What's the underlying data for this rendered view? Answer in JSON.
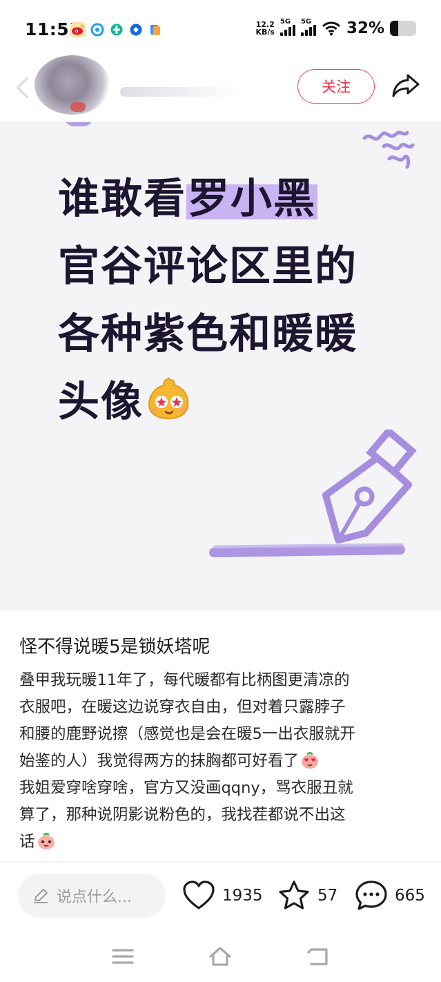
{
  "status_bar": {
    "time": "11:55",
    "net_speed_value": "12.2",
    "net_speed_unit": "KB/s",
    "signal1_label": "5G",
    "signal2_label": "5G",
    "battery_percent": "32%",
    "battery_level": 0.32,
    "app_icons": [
      "weibo-icon",
      "browser-icon",
      "ticket-app-icon",
      "blue-app-icon",
      "files-icon"
    ]
  },
  "header": {
    "follow_label": "关注"
  },
  "hero": {
    "line1_plain": "谁敢看",
    "line1_highlight": "罗小黑",
    "line2": "官谷评论区里的",
    "line3": "各种紫色和暖暖",
    "line4": "头像"
  },
  "post": {
    "title": "怪不得说暖5是锁妖塔呢",
    "lines": [
      "叠甲我玩暖11年了，每代暖都有比柄图更清凉的",
      "衣服吧，在暖这边说穿衣自由，但对着只露脖子",
      "和腰的鹿野说擦（感觉也是会在暖5一出衣服就开",
      "始鉴的人）我觉得两方的抹胸都可好看了",
      "我姐爱穿啥穿啥，官方又没画qqny，骂衣服丑就",
      "算了，那种说阴影说粉色的，我找茬都说不出这",
      "话"
    ]
  },
  "bottom_bar": {
    "comment_placeholder": "说点什么...",
    "like_count": "1935",
    "star_count": "57",
    "comment_count": "665"
  },
  "colors": {
    "accent_red": "#e8334a",
    "highlight_purple": "#c9b3f3",
    "doodle_purple": "#a58ddf",
    "hero_text": "#1e1530"
  }
}
